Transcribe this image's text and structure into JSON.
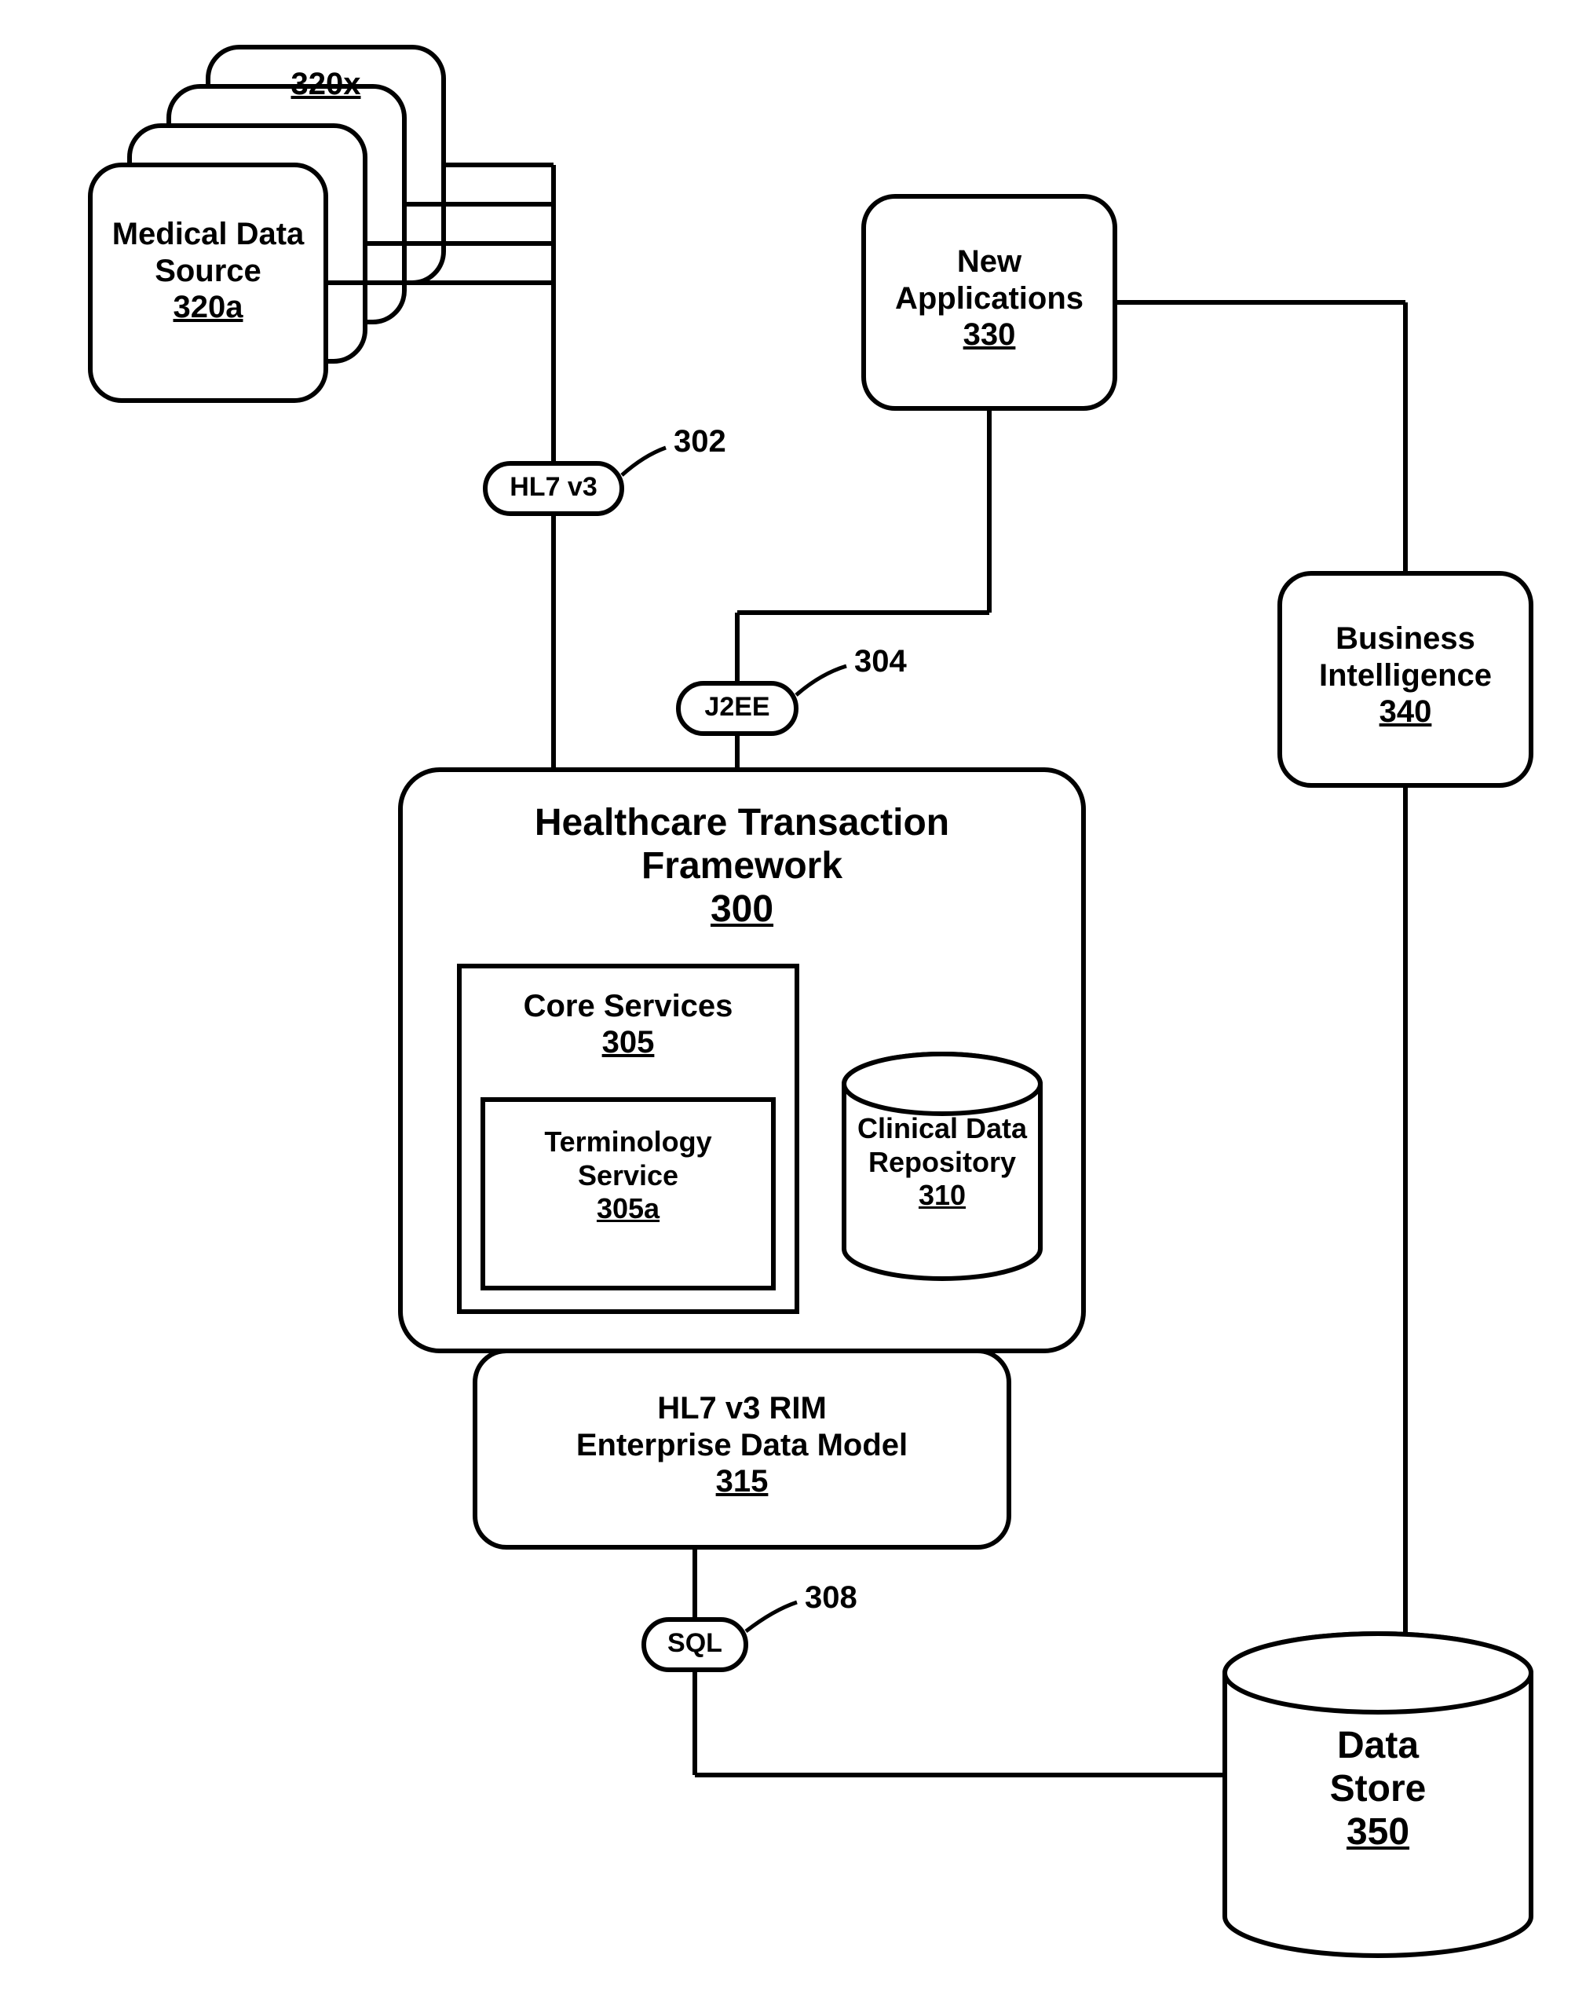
{
  "nodes": {
    "mds": {
      "line1": "Medical Data",
      "line2": "Source",
      "ref": "320a"
    },
    "mds_top": {
      "ref": "320x"
    },
    "htf": {
      "line1": "Healthcare Transaction",
      "line2": "Framework",
      "ref": "300"
    },
    "core": {
      "title": "Core Services",
      "ref": "305"
    },
    "term": {
      "line1": "Terminology",
      "line2": "Service",
      "ref": "305a"
    },
    "cdr": {
      "line1": "Clinical Data",
      "line2": "Repository",
      "ref": "310"
    },
    "edm": {
      "line1": "HL7 v3 RIM",
      "line2": "Enterprise Data Model",
      "ref": "315"
    },
    "newapps": {
      "line1": "New",
      "line2": "Applications",
      "ref": "330"
    },
    "bi": {
      "line1": "Business",
      "line2": "Intelligence",
      "ref": "340"
    },
    "ds": {
      "line1": "Data",
      "line2": "Store",
      "ref": "350"
    }
  },
  "pills": {
    "hl7": {
      "label": "HL7 v3",
      "callout": "302"
    },
    "j2ee": {
      "label": "J2EE",
      "callout": "304"
    },
    "sql": {
      "label": "SQL",
      "callout": "308"
    }
  }
}
